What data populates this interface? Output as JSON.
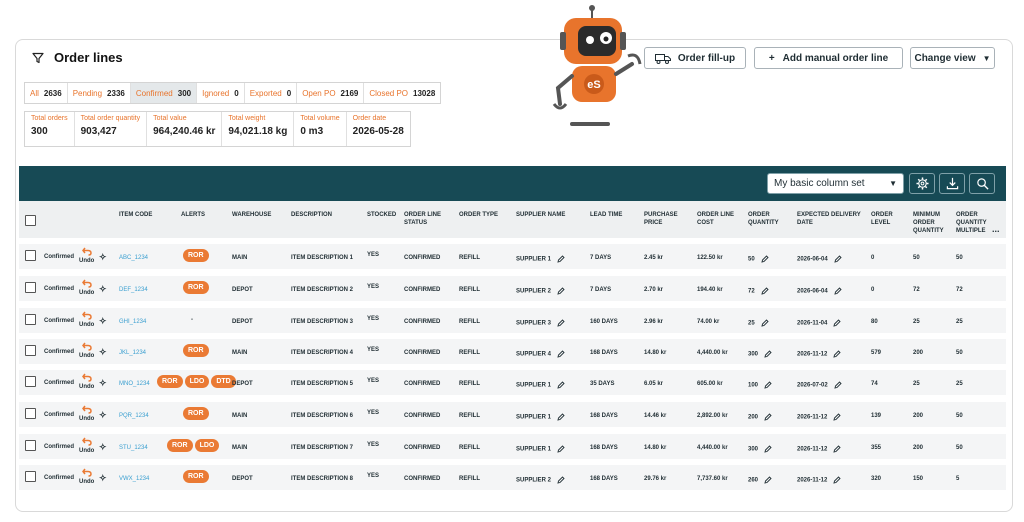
{
  "header": {
    "title": "Order lines"
  },
  "tabs": [
    {
      "label": "All",
      "count": "2636"
    },
    {
      "label": "Pending",
      "count": "2336"
    },
    {
      "label": "Confirmed",
      "count": "300"
    },
    {
      "label": "Ignored",
      "count": "0"
    },
    {
      "label": "Exported",
      "count": "0"
    },
    {
      "label": "Open PO",
      "count": "2169"
    },
    {
      "label": "Closed PO",
      "count": "13028"
    }
  ],
  "active_tab": "Confirmed",
  "stats": [
    {
      "label": "Total orders",
      "value": "300"
    },
    {
      "label": "Total order quantity",
      "value": "903,427"
    },
    {
      "label": "Total value",
      "value": "964,240.46 kr"
    },
    {
      "label": "Total weight",
      "value": "94,021.18 kg"
    },
    {
      "label": "Total volume",
      "value": "0 m3"
    },
    {
      "label": "Order date",
      "value": "2026-05-28"
    }
  ],
  "buttons": {
    "order_fillup": "Order fill-up",
    "add_manual": "+   Add manual order line",
    "change_view": "Change view"
  },
  "robot": {
    "chest_text": "eS"
  },
  "toolbar": {
    "column_set": "My basic column set"
  },
  "columns": [
    "Item code",
    "Alerts",
    "Warehouse",
    "Description",
    "Stocked",
    "Order line status",
    "Order type",
    "Supplier name",
    "Lead time",
    "Purchase price",
    "Order line cost",
    "Order quantity",
    "Expected delivery date",
    "Order level",
    "Minimum order quantity",
    "Order quantity multiple"
  ],
  "more_columns": "...",
  "undo_label": "Undo",
  "rows": [
    {
      "status": "Confirmed",
      "item_code": "ABC_1234",
      "alerts": [
        "ROR"
      ],
      "warehouse": "MAIN",
      "description": "ITEM DESCRIPTION 1",
      "stocked": "YES",
      "line_status": "CONFIRMED",
      "order_type": "REFILL",
      "supplier": "SUPPLIER 1",
      "lead_time": "7 DAYS",
      "price": "2.45 kr",
      "cost": "122.50 kr",
      "qty": "50",
      "delivery": "2026-06-04",
      "level": "0",
      "min_qty": "50",
      "multiple": "50"
    },
    {
      "status": "Confirmed",
      "item_code": "DEF_1234",
      "alerts": [
        "ROR"
      ],
      "warehouse": "DEPOT",
      "description": "ITEM DESCRIPTION 2",
      "stocked": "YES",
      "line_status": "CONFIRMED",
      "order_type": "REFILL",
      "supplier": "SUPPLIER 2",
      "lead_time": "7 DAYS",
      "price": "2.70 kr",
      "cost": "194.40 kr",
      "qty": "72",
      "delivery": "2026-06-04",
      "level": "0",
      "min_qty": "72",
      "multiple": "72"
    },
    {
      "status": "Confirmed",
      "item_code": "GHI_1234",
      "alerts": [
        "-"
      ],
      "warehouse": "DEPOT",
      "description": "ITEM DESCRIPTION 3",
      "stocked": "YES",
      "line_status": "CONFIRMED",
      "order_type": "REFILL",
      "supplier": "SUPPLIER 3",
      "lead_time": "160 DAYS",
      "price": "2.96 kr",
      "cost": "74.00 kr",
      "qty": "25",
      "delivery": "2026-11-04",
      "level": "80",
      "min_qty": "25",
      "multiple": "25"
    },
    {
      "status": "Confirmed",
      "item_code": "JKL_1234",
      "alerts": [
        "ROR"
      ],
      "warehouse": "MAIN",
      "description": "ITEM DESCRIPTION 4",
      "stocked": "YES",
      "line_status": "CONFIRMED",
      "order_type": "REFILL",
      "supplier": "SUPPLIER 4",
      "lead_time": "168 DAYS",
      "price": "14.80 kr",
      "cost": "4,440.00 kr",
      "qty": "300",
      "delivery": "2026-11-12",
      "level": "579",
      "min_qty": "200",
      "multiple": "50"
    },
    {
      "status": "Confirmed",
      "item_code": "MNO_1234",
      "alerts": [
        "ROR",
        "LDO",
        "DTD"
      ],
      "warehouse": "DEPOT",
      "description": "ITEM DESCRIPTION 5",
      "stocked": "YES",
      "line_status": "CONFIRMED",
      "order_type": "REFILL",
      "supplier": "SUPPLIER 1",
      "lead_time": "35 DAYS",
      "price": "6.05 kr",
      "cost": "605.00 kr",
      "qty": "100",
      "delivery": "2026-07-02",
      "level": "74",
      "min_qty": "25",
      "multiple": "25"
    },
    {
      "status": "Confirmed",
      "item_code": "PQR_1234",
      "alerts": [
        "ROR"
      ],
      "warehouse": "MAIN",
      "description": "ITEM DESCRIPTION 6",
      "stocked": "YES",
      "line_status": "CONFIRMED",
      "order_type": "REFILL",
      "supplier": "SUPPLIER 1",
      "lead_time": "168 DAYS",
      "price": "14.46 kr",
      "cost": "2,892.00 kr",
      "qty": "200",
      "delivery": "2026-11-12",
      "level": "139",
      "min_qty": "200",
      "multiple": "50"
    },
    {
      "status": "Confirmed",
      "item_code": "STU_1234",
      "alerts": [
        "ROR",
        "LDO"
      ],
      "warehouse": "MAIN",
      "description": "ITEM DESCRIPTION 7",
      "stocked": "YES",
      "line_status": "CONFIRMED",
      "order_type": "REFILL",
      "supplier": "SUPPLIER 1",
      "lead_time": "168 DAYS",
      "price": "14.80 kr",
      "cost": "4,440.00 kr",
      "qty": "300",
      "delivery": "2026-11-12",
      "level": "355",
      "min_qty": "200",
      "multiple": "50"
    },
    {
      "status": "Confirmed",
      "item_code": "VWX_1234",
      "alerts": [
        "ROR"
      ],
      "warehouse": "DEPOT",
      "description": "ITEM DESCRIPTION 8",
      "stocked": "YES",
      "line_status": "CONFIRMED",
      "order_type": "REFILL",
      "supplier": "SUPPLIER 2",
      "lead_time": "168 DAYS",
      "price": "29.76 kr",
      "cost": "7,737.60 kr",
      "qty": "260",
      "delivery": "2026-11-12",
      "level": "320",
      "min_qty": "150",
      "multiple": "5"
    }
  ],
  "colors": {
    "accent": "#ea7a34",
    "toolbar": "#174a55",
    "link": "#3a9fd0"
  }
}
